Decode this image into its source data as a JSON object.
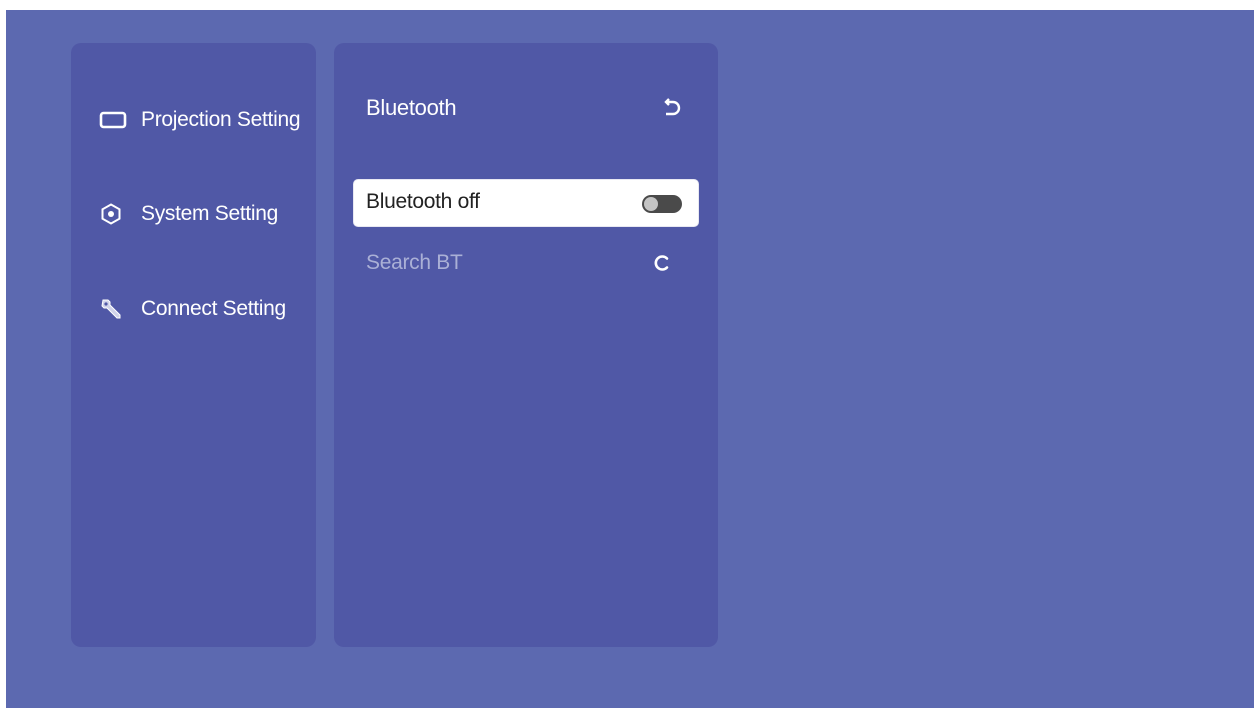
{
  "sidebar": {
    "items": [
      {
        "label": "Projection Setting",
        "icon": "screen-icon"
      },
      {
        "label": "System Setting",
        "icon": "settings-icon"
      },
      {
        "label": "Connect Setting",
        "icon": "wrench-icon"
      }
    ]
  },
  "detail": {
    "title": "Bluetooth",
    "back_icon": "back-arrow-icon",
    "bluetooth_row": {
      "label": "Bluetooth off",
      "toggle_state": "off"
    },
    "search_row": {
      "label": "Search BT",
      "icon": "refresh-icon"
    }
  },
  "colors": {
    "background": "#5c69b0",
    "panel": "#5058a6",
    "selected_row": "#ffffff",
    "dim_text": "#aab0d6"
  }
}
